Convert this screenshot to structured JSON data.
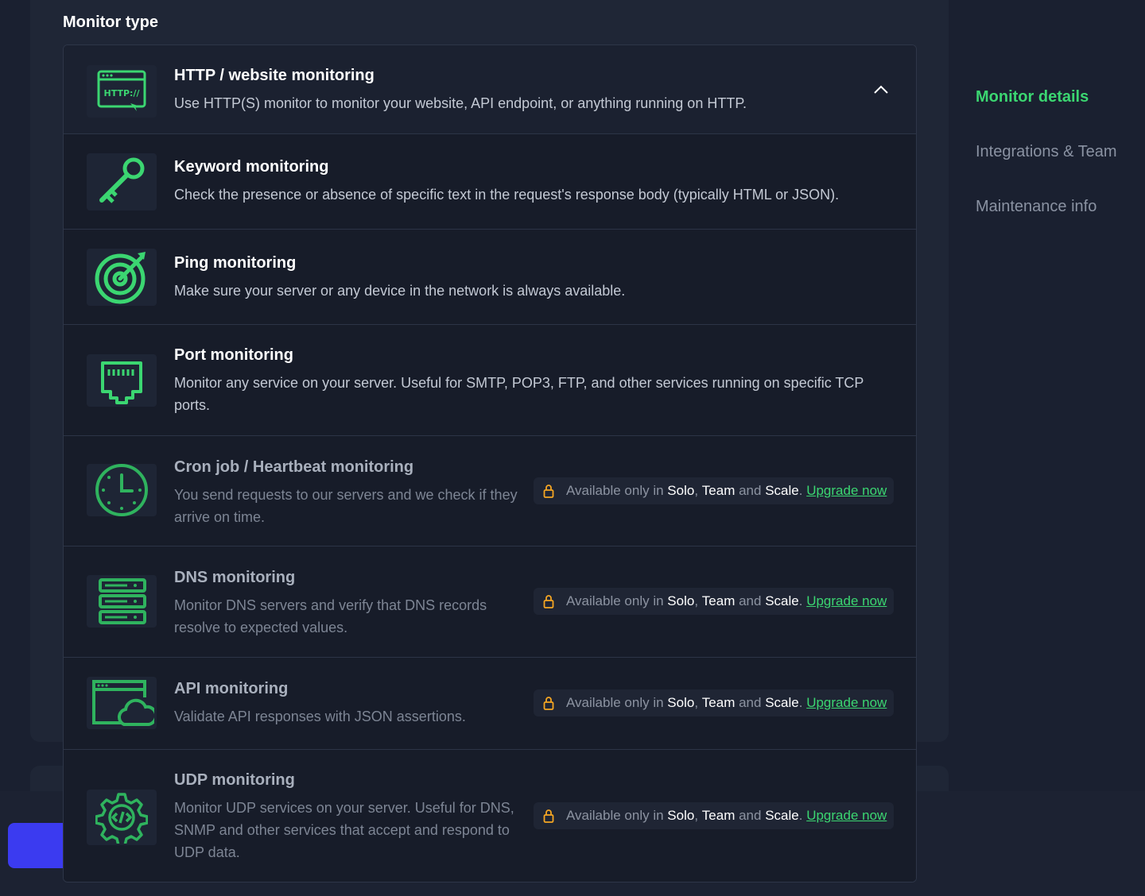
{
  "section_title": "Monitor type",
  "colors": {
    "accent": "#3bd671",
    "lock": "#f5a623",
    "button": "#3b3bf0"
  },
  "options": [
    {
      "title": "HTTP / website monitoring",
      "desc": "Use HTTP(S) monitor to monitor your website, API endpoint, or anything running on HTTP.",
      "icon": "http-browser-icon",
      "icon_text": "HTTP://"
    },
    {
      "title": "Keyword monitoring",
      "desc": "Check the presence or absence of specific text in the request's response body (typically HTML or JSON).",
      "icon": "key-icon"
    },
    {
      "title": "Ping monitoring",
      "desc": "Make sure your server or any device in the network is always available.",
      "icon": "target-icon"
    },
    {
      "title": "Port monitoring",
      "desc_line1": "Monitor any service on your server. Useful for SMTP, POP3, FTP, and other services running on specific TCP",
      "desc_line2": "ports.",
      "icon": "ethernet-port-icon"
    },
    {
      "title": "Cron job / Heartbeat monitoring",
      "desc_line1": "You send requests to our servers and we check if they",
      "desc_line2": "arrive on time.",
      "icon": "clock-icon"
    },
    {
      "title": "DNS monitoring",
      "desc_line1": "Monitor DNS servers and verify that DNS records",
      "desc_line2": "resolve to expected values.",
      "icon": "server-stack-icon"
    },
    {
      "title": "API monitoring",
      "desc": "Validate API responses with JSON assertions.",
      "icon": "browser-cloud-icon"
    },
    {
      "title": "UDP monitoring",
      "desc_line1": "Monitor UDP services on your server. Useful for DNS,",
      "desc_line2": "SNMP and other services that accept and respond to",
      "desc_line3": "UDP data.",
      "icon": "gear-code-icon"
    }
  ],
  "lock_badge": {
    "prefix": "Available only in",
    "plan1": "Solo",
    "sep1": ",",
    "plan2": "Team",
    "and": "and",
    "plan3": "Scale",
    "period": ".",
    "upgrade": "Upgrade now",
    "icon": "lock-icon"
  },
  "side_nav": {
    "items": [
      "Monitor details",
      "Integrations & Team",
      "Maintenance info"
    ],
    "active": "Monitor details"
  }
}
